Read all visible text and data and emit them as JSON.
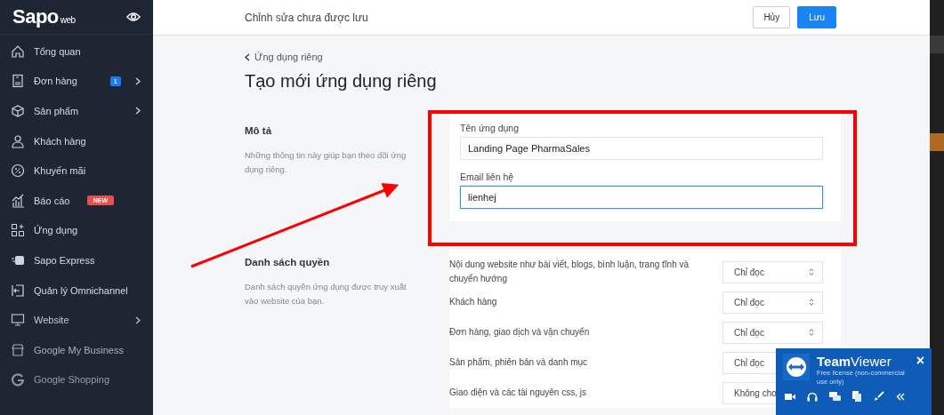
{
  "sidebar": {
    "logo": "Sapo",
    "logo_suffix": "web",
    "items": [
      {
        "label": "Tổng quan",
        "chevron": false
      },
      {
        "label": "Đơn hàng",
        "badge": {
          "text": "1",
          "kind": "count"
        },
        "chevron": true
      },
      {
        "label": "Sản phẩm",
        "chevron": true
      },
      {
        "label": "Khách hàng",
        "chevron": false
      },
      {
        "label": "Khuyến mãi",
        "chevron": false
      },
      {
        "label": "Báo cáo",
        "badge": {
          "text": "NEW",
          "kind": "new"
        },
        "chevron": false
      },
      {
        "label": "Ứng dụng",
        "chevron": false
      },
      {
        "label": "Sapo Express",
        "chevron": false
      },
      {
        "label": "Quản lý Omnichannel",
        "chevron": false
      },
      {
        "label": "Website",
        "chevron": true
      },
      {
        "label": "Google My Business",
        "chevron": false
      },
      {
        "label": "Google Shopping",
        "chevron": false
      }
    ]
  },
  "topbar": {
    "status": "Chỉnh sửa chưa được lưu",
    "cancel": "Hủy",
    "save": "Lưu"
  },
  "breadcrumb": "Ứng dụng riêng",
  "title": "Tạo mới ứng dụng riêng",
  "description": {
    "heading": "Mô tả",
    "text": "Những thông tin này giúp bạn theo dõi ứng dụng riêng.",
    "fields": [
      {
        "label": "Tên ứng dụng",
        "value": "Landing Page PharmaSales",
        "focused": false
      },
      {
        "label": "Email liên hệ",
        "value": "lienhej",
        "focused": true
      }
    ]
  },
  "permissions": {
    "heading": "Danh sách quyền",
    "text": "Danh sách quyền ứng dụng được truy xuất vào website của bạn.",
    "rows": [
      {
        "label": "Nội dung website như bài viết, blogs, bình luận, trang tĩnh và chuyển hướng",
        "value": "Chỉ đọc"
      },
      {
        "label": "Khách hàng",
        "value": "Chỉ đọc"
      },
      {
        "label": "Đơn hàng, giao dịch và vận chuyển",
        "value": "Chỉ đọc"
      },
      {
        "label": "Sản phẩm, phiên bản và danh mục",
        "value": "Chỉ đọc"
      },
      {
        "label": "Giao diện và các tài nguyên css, js",
        "value": "Không cho"
      }
    ]
  },
  "teamviewer": {
    "brand_bold": "Team",
    "brand_rest": "Viewer",
    "license": "Free license (non-commercial use only)",
    "close": "×"
  }
}
